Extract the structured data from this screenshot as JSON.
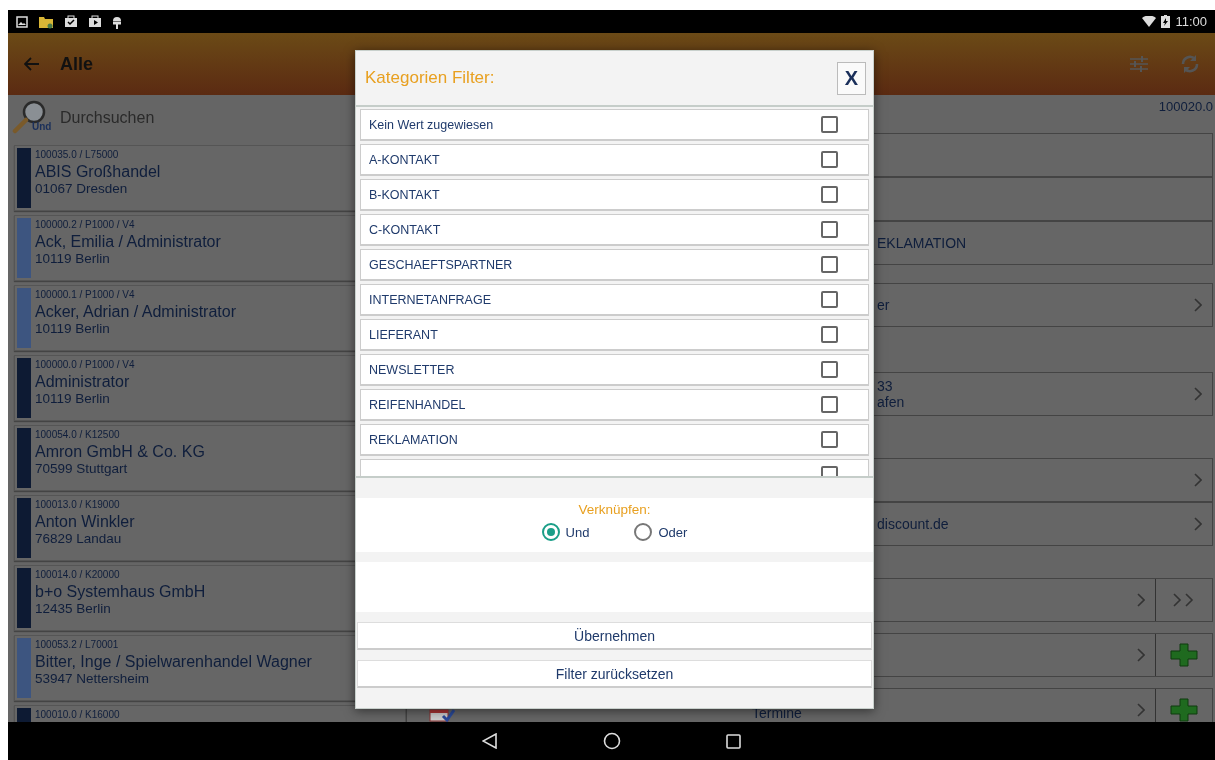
{
  "status_bar": {
    "time": "11:00"
  },
  "app_bar": {
    "title": "Alle"
  },
  "search": {
    "mode_label": "Und",
    "placeholder": "Durchsuchen"
  },
  "contacts": [
    {
      "code": "100035.0 / L75000",
      "name": "ABIS Großhandel",
      "city": "01067 Dresden",
      "color": "#0d1a33"
    },
    {
      "code": "100000.2 / P1000 / V4",
      "name": "Ack, Emilia / Administrator",
      "city": "10119 Berlin",
      "color": "#3d5580"
    },
    {
      "code": "100000.1 / P1000 / V4",
      "name": "Acker, Adrian / Administrator",
      "city": "10119 Berlin",
      "color": "#3d5580"
    },
    {
      "code": "100000.0 / P1000 / V4",
      "name": "Administrator",
      "city": "10119 Berlin",
      "color": "#0d1a33"
    },
    {
      "code": "100054.0 / K12500",
      "name": "Amron GmbH & Co. KG",
      "city": "70599 Stuttgart",
      "color": "#0d1a33"
    },
    {
      "code": "100013.0 / K19000",
      "name": "Anton Winkler",
      "city": "76829 Landau",
      "color": "#0d1a33"
    },
    {
      "code": "100014.0 / K20000",
      "name": "b+o Systemhaus GmbH",
      "city": "12435 Berlin",
      "color": "#0d1a33"
    },
    {
      "code": "100053.2 / L70001",
      "name": "Bitter, Inge / Spielwarenhandel Wagner",
      "city": "53947 Nettersheim",
      "color": "#3d5580"
    },
    {
      "code": "100010.0 / K16000",
      "color": "#0d1a33"
    }
  ],
  "detail": {
    "id": "100020.0",
    "sections": [
      {
        "rows": [
          {
            "kind": "plain",
            "lines": []
          },
          {
            "kind": "plain",
            "lines": []
          },
          {
            "kind": "plain",
            "lines": [
              "EKLAMATION"
            ]
          }
        ]
      },
      {
        "rows": [
          {
            "kind": "chevron",
            "lines": [
              "er"
            ]
          }
        ]
      },
      {
        "rows": [
          {
            "kind": "chevron",
            "lines": [
              "33",
              "afen"
            ]
          }
        ]
      },
      {
        "rows": [
          {
            "kind": "chevron",
            "lines": []
          },
          {
            "kind": "chevron",
            "lines": [
              "discount.de"
            ]
          }
        ]
      },
      {
        "rows": [
          {
            "kind": "double",
            "lines": []
          }
        ]
      },
      {
        "rows": [
          {
            "kind": "add",
            "lines": []
          }
        ]
      },
      {
        "rows": [
          {
            "kind": "add",
            "lines": [],
            "center": "Termine"
          }
        ]
      }
    ]
  },
  "dialog": {
    "title": "Kategorien Filter:",
    "close": "X",
    "categories": [
      {
        "label": "Kein Wert zugewiesen",
        "checked": false
      },
      {
        "label": "A-KONTAKT",
        "checked": false
      },
      {
        "label": "B-KONTAKT",
        "checked": false
      },
      {
        "label": "C-KONTAKT",
        "checked": false
      },
      {
        "label": "GESCHAEFTSPARTNER",
        "checked": false
      },
      {
        "label": "INTERNETANFRAGE",
        "checked": false
      },
      {
        "label": "LIEFERANT",
        "checked": false
      },
      {
        "label": "NEWSLETTER",
        "checked": false
      },
      {
        "label": "REIFENHANDEL",
        "checked": false
      },
      {
        "label": "REKLAMATION",
        "checked": false
      },
      {
        "checked": false
      }
    ],
    "link_label": "Verknüpfen:",
    "link_options": [
      {
        "label": "Und",
        "selected": true
      },
      {
        "label": "Oder",
        "selected": false
      }
    ],
    "buttons": [
      "Übernehmen",
      "Filter zurücksetzen"
    ]
  }
}
